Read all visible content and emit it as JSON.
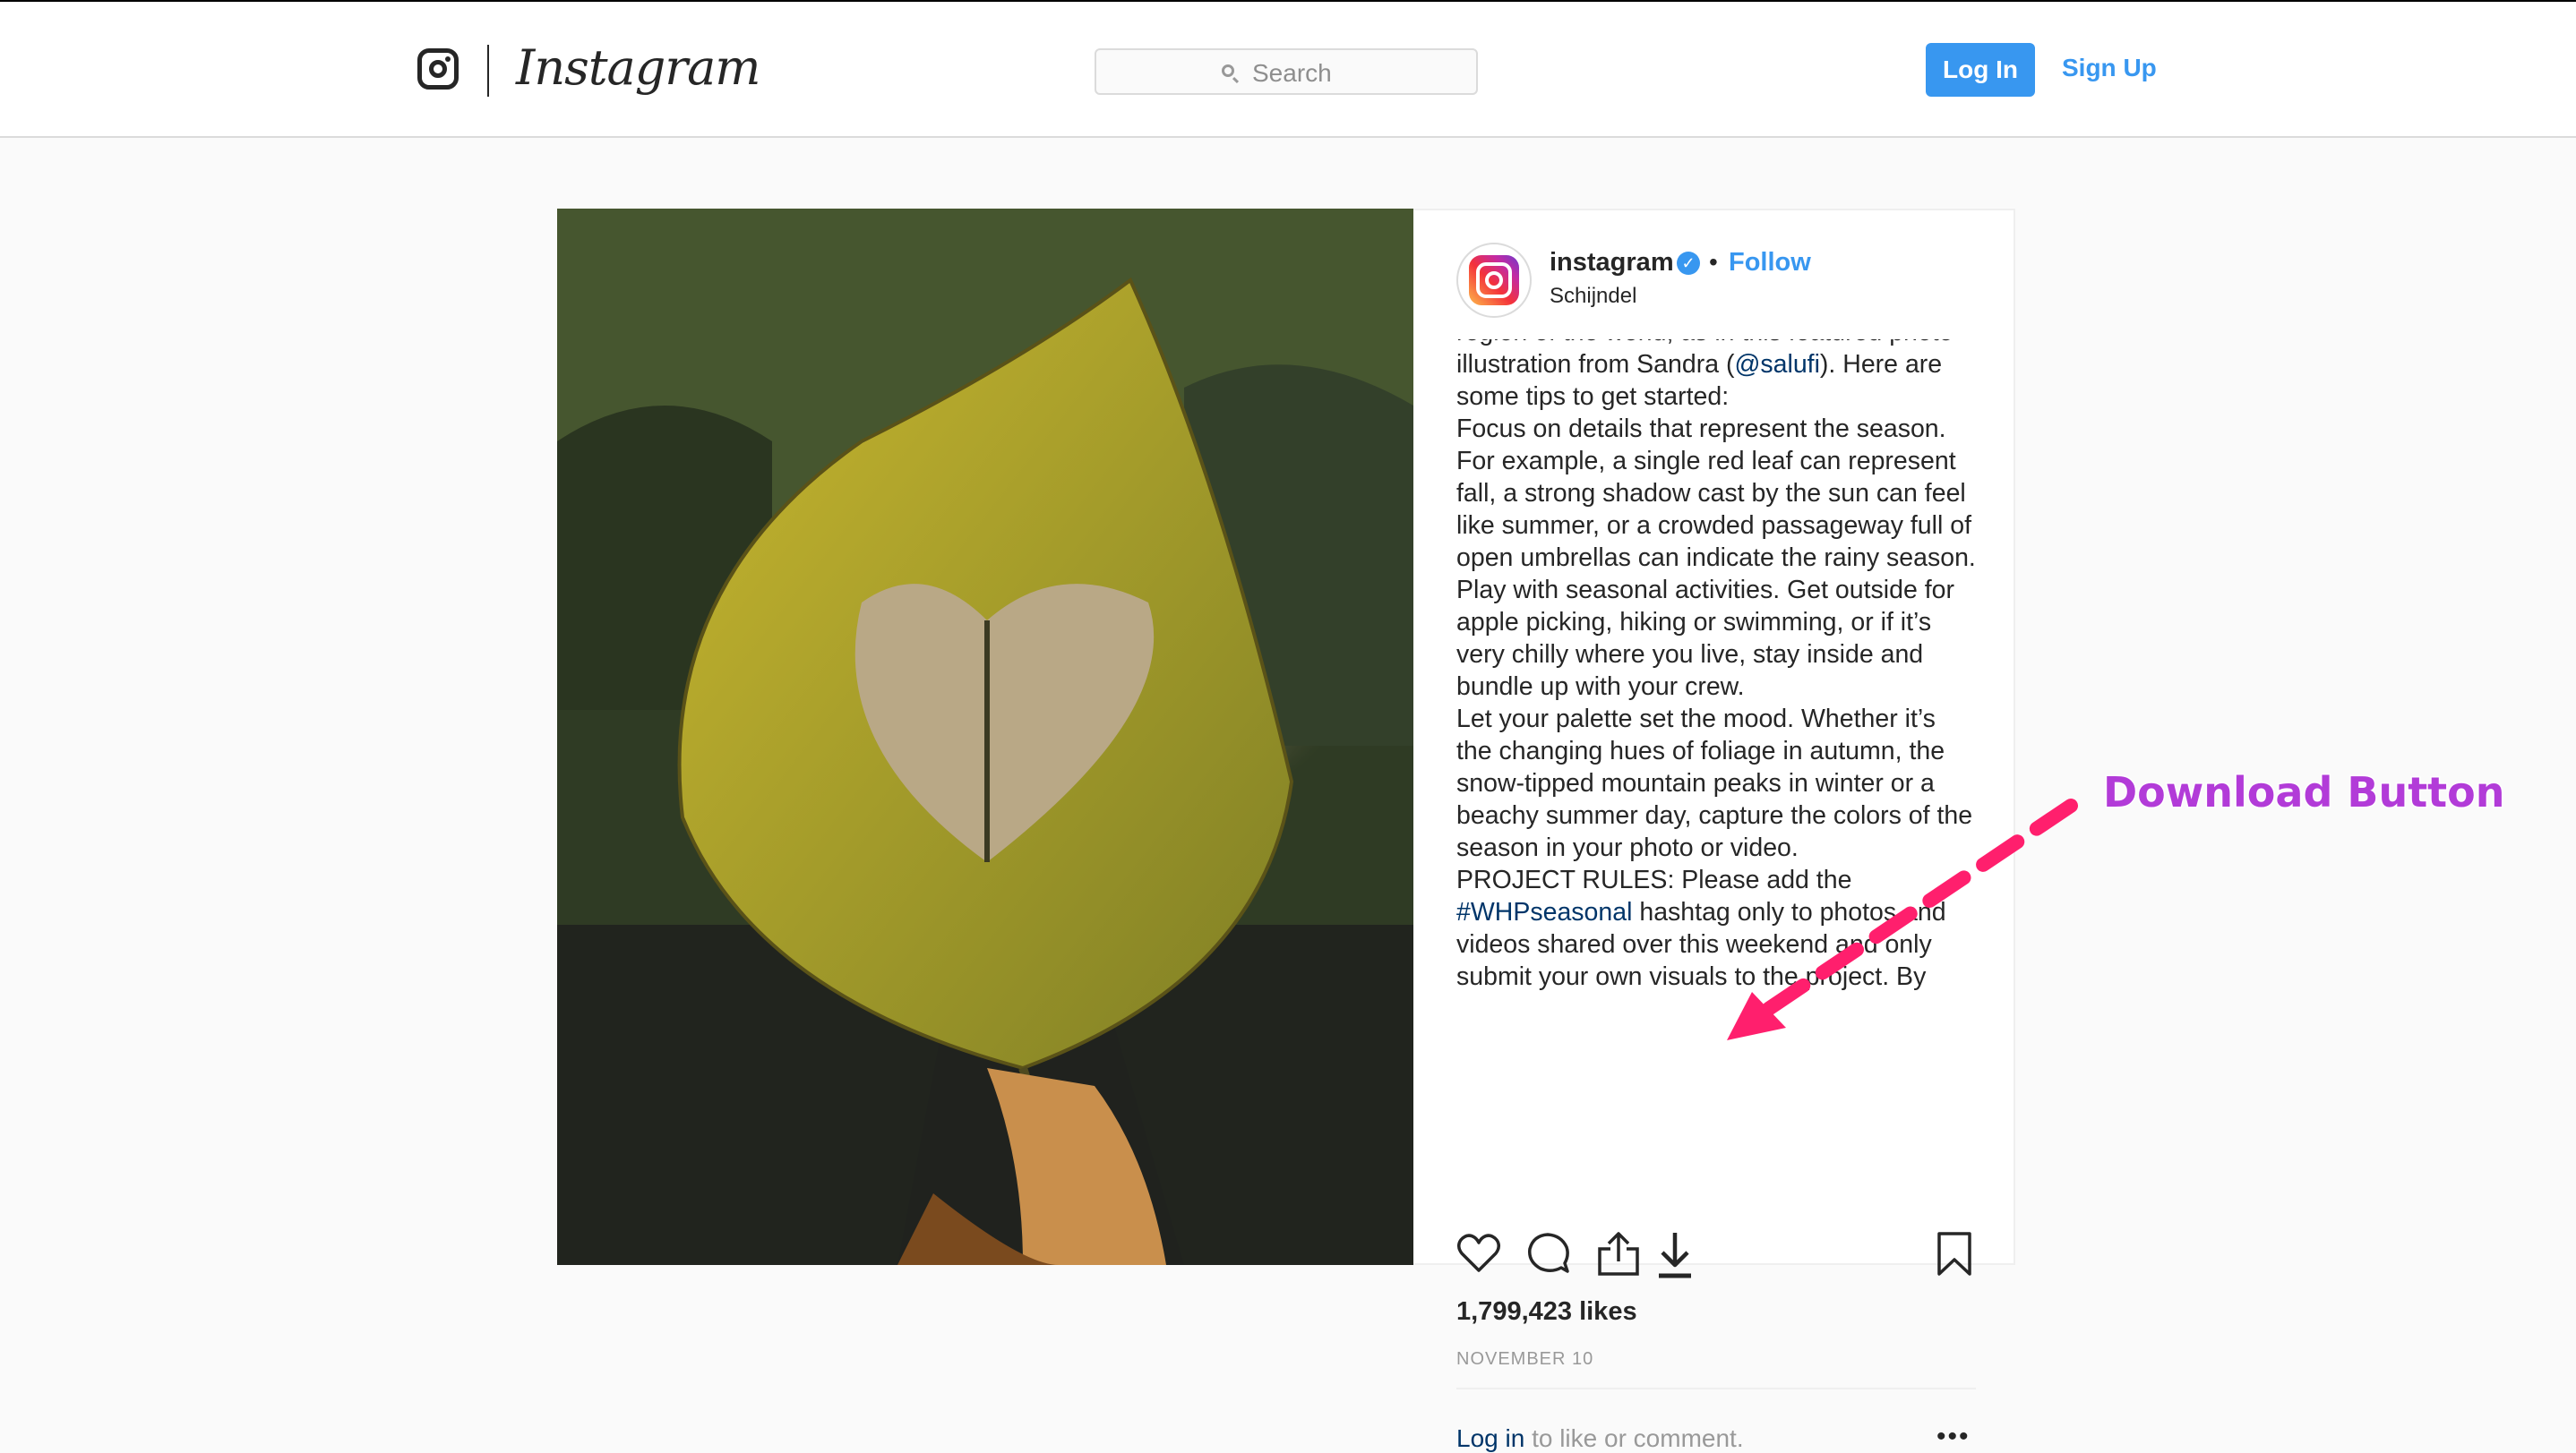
{
  "header": {
    "brand": "Instagram",
    "search_placeholder": "Search",
    "login_label": "Log In",
    "signup_label": "Sign Up"
  },
  "post": {
    "username": "instagram",
    "verified_glyph": "✓",
    "dot": "•",
    "follow_label": "Follow",
    "location": "Schijndel",
    "caption": {
      "top_partial": "region of the world, as in this featured photo",
      "p1_pre": "illustration from Sandra (",
      "p1_mention": "@salufi",
      "p1_post": "). Here are some tips to get started:",
      "p2": "Focus on details that represent the season. For example, a single red leaf can represent fall, a strong shadow cast by the sun can feel like summer, or a crowded passageway full of open umbrellas can indicate the rainy season.",
      "p3": "Play with seasonal activities. Get outside for apple picking, hiking or swimming, or if it’s very chilly where you live, stay inside and bundle up with your crew.",
      "p4": "Let your palette set the mood. Whether it’s the changing hues of foliage in autumn, the snow-tipped mountain peaks in winter or a beachy summer day, capture the colors of the season in your photo or video.",
      "p5_pre": "PROJECT RULES: Please add the ",
      "p5_hashtag": "#WHPseasonal",
      "p5_post": " hashtag only to photos and videos shared over this weekend and only submit your own visuals to the project. By"
    },
    "likes": "1,799,423 likes",
    "date": "NOVEMBER 10",
    "login_link": "Log in",
    "login_rest": " to like or comment.",
    "more_glyph": "•••",
    "icons": [
      "heart-icon",
      "comment-icon",
      "share-icon",
      "download-icon",
      "bookmark-icon"
    ]
  },
  "annotation": {
    "label": "Download Button",
    "color": "#ff1f6d"
  },
  "colors": {
    "accent": "#3897f0",
    "link": "#003569",
    "annotation_text": "#b23bd8"
  }
}
